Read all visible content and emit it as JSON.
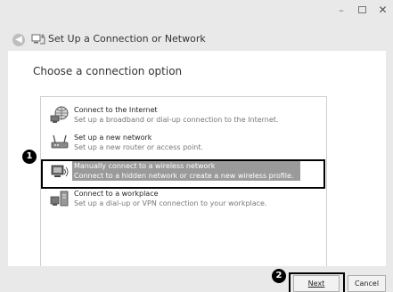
{
  "window": {
    "minimize_glyph": "–",
    "close_glyph": "✕"
  },
  "header": {
    "back_glyph": "◀",
    "title": "Set Up a Connection or Network"
  },
  "content": {
    "heading": "Choose a connection option"
  },
  "options": [
    {
      "title": "Connect to the Internet",
      "description": "Set up a broadband or dial-up connection to the Internet.",
      "icon": "globe-network-icon"
    },
    {
      "title": "Set up a new network",
      "description": "Set up a new router or access point.",
      "icon": "router-icon"
    },
    {
      "title": "Manually connect to a wireless network",
      "description": "Connect to a hidden network or create a new wireless profile.",
      "icon": "wireless-computer-icon"
    },
    {
      "title": "Connect to a workplace",
      "description": "Set up a dial-up or VPN connection to your workplace.",
      "icon": "workplace-vpn-icon"
    }
  ],
  "selected_index": 2,
  "callouts": {
    "one": "1",
    "two": "2"
  },
  "buttons": {
    "next": "Next",
    "cancel": "Cancel"
  },
  "colors": {
    "selection": "#9a9a9a",
    "window_bg": "#e9e9e9"
  }
}
